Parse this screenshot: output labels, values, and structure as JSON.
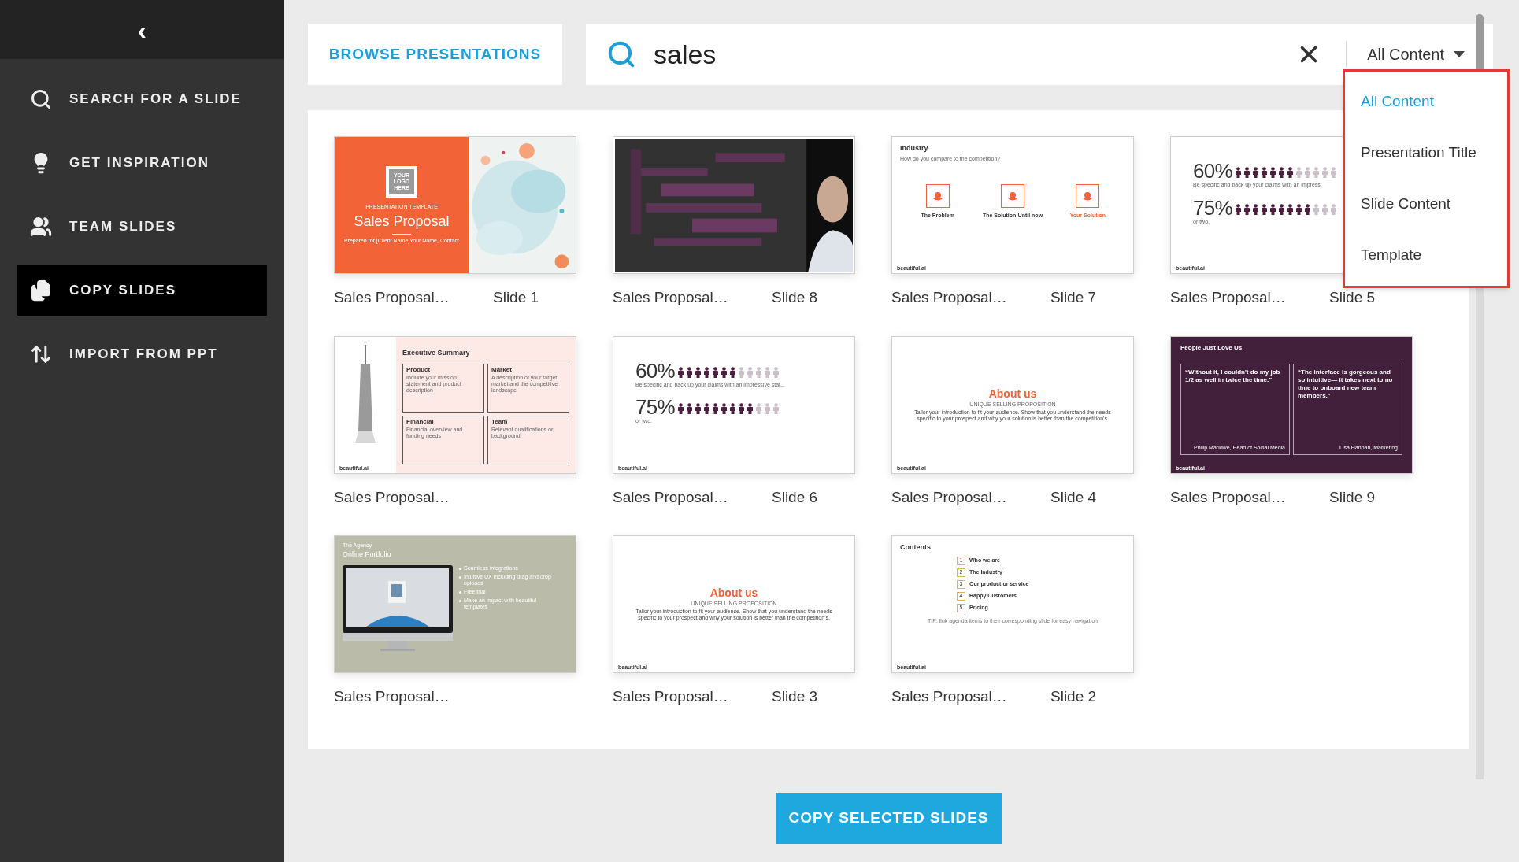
{
  "sidebar": {
    "back": "‹",
    "items": [
      {
        "label": "SEARCH FOR A SLIDE",
        "kind": "search",
        "selected": false
      },
      {
        "label": "GET INSPIRATION",
        "kind": "bulb",
        "selected": false
      },
      {
        "label": "TEAM SLIDES",
        "kind": "team",
        "selected": false
      },
      {
        "label": "COPY SLIDES",
        "kind": "copy",
        "selected": true
      },
      {
        "label": "IMPORT FROM PPT",
        "kind": "import",
        "selected": false
      }
    ]
  },
  "browse_button": "BROWSE PRESENTATIONS",
  "search": {
    "value": "sales"
  },
  "filter": {
    "label": "All Content",
    "expanded": true,
    "options": [
      {
        "label": "All Content",
        "selected": true
      },
      {
        "label": "Presentation Title",
        "selected": false
      },
      {
        "label": "Slide Content",
        "selected": false
      },
      {
        "label": "Template",
        "selected": false
      }
    ]
  },
  "slides": [
    {
      "kind": "cover",
      "name": "Sales Proposal…",
      "slide": "Slide 1",
      "logo": "YOUR LOGO HERE",
      "eyebrow": "PRESENTATION TEMPLATE",
      "title": "Sales Proposal",
      "subtitle": "Prepared for [Client Name]Your Name, Contact"
    },
    {
      "kind": "wordcloud",
      "name": "Sales Proposal…",
      "slide": "Slide 8"
    },
    {
      "kind": "icons",
      "name": "Sales Proposal…",
      "slide": "Slide 7",
      "title": "Industry",
      "subtitle": "How do you compare to the competition?",
      "items": [
        {
          "label": "The Problem",
          "highlight": false
        },
        {
          "label": "The Solution-Until now",
          "highlight": false
        },
        {
          "label": "Your Solution",
          "highlight": true
        }
      ],
      "footer": "beautiful.ai"
    },
    {
      "kind": "stats",
      "name": "Sales Proposal…",
      "slide": "Slide 5",
      "stats": [
        {
          "value": "60%",
          "level": 0.6
        },
        {
          "value": "75%",
          "level": 0.75
        }
      ],
      "caption": "Be specific and back up your claims with an impress",
      "note": "or two.",
      "footer": "beautiful.ai"
    },
    {
      "kind": "summary",
      "name": "Sales Proposal…",
      "title": "Executive Summary",
      "boxes": [
        {
          "heading": "Product",
          "text": "Include your mission statement and product description"
        },
        {
          "heading": "Market",
          "text": "A description of your target market and the competitive landscape"
        },
        {
          "heading": "Financial",
          "text": "Financial overview and funding needs"
        },
        {
          "heading": "Team",
          "text": "Relevant qualifications or background"
        }
      ],
      "footer": "beautiful.ai"
    },
    {
      "kind": "stats",
      "name": "Sales Proposal…",
      "slide": "Slide 6",
      "stats": [
        {
          "value": "60%",
          "level": 0.6
        },
        {
          "value": "75%",
          "level": 0.75
        }
      ],
      "caption": "Be specific and back up your claims with an impressive stat...",
      "note": "or two.",
      "footer": "beautiful.ai"
    },
    {
      "kind": "about",
      "name": "Sales Proposal…",
      "slide": "Slide 4",
      "title": "About us",
      "eyebrow": "UNIQUE SELLING PROPOSITION",
      "text": "Tailor your introduction to fit your audience. Show that you understand the needs specific to your prospect and why your solution is better than the competition's.",
      "footer": "beautiful.ai"
    },
    {
      "kind": "quotes",
      "name": "Sales Proposal…",
      "slide": "Slide 9",
      "title": "People Just Love Us",
      "quotes": [
        {
          "text": "“Without it, I couldn't do my  job 1/2 as well in twice the time.”",
          "author": "Philip Marlowe, Head of Social Media"
        },
        {
          "text": "“The interface is gorgeous and so intuitive— it takes next to no time to onboard new team members.”",
          "author": "Lisa Hannah, Marketing"
        }
      ],
      "footer": "beautiful.ai"
    },
    {
      "kind": "portfolio",
      "name": "Sales Proposal…",
      "eyebrow": "The Agency",
      "title": "Online Portfolio",
      "bullets": [
        "Seamless integrations",
        "Intuitive UX including drag and drop uploads",
        "Free trial",
        "Make an impact with beautiful templates"
      ]
    },
    {
      "kind": "about",
      "name": "Sales Proposal…",
      "slide": "Slide 3",
      "title": "About us",
      "eyebrow": "UNIQUE SELLING PROPOSITION",
      "text": "Tailor your introduction to fit your audience. Show that you understand the needs specific to your prospect and why your solution is better than the competition's.",
      "footer": "beautiful.ai"
    },
    {
      "kind": "contents",
      "name": "Sales Proposal…",
      "slide": "Slide 2",
      "title": "Contents",
      "items": [
        {
          "num": "1",
          "label": "Who we are"
        },
        {
          "num": "2",
          "label": "The Industry"
        },
        {
          "num": "3",
          "label": "Our product or service"
        },
        {
          "num": "4",
          "label": "Happy Customers"
        },
        {
          "num": "5",
          "label": "Pricing"
        }
      ],
      "tip": "TIP: link agenda items to their corresponding slide for easy navigation",
      "footer": "beautiful.ai"
    }
  ],
  "copy_button": "COPY SELECTED SLIDES"
}
